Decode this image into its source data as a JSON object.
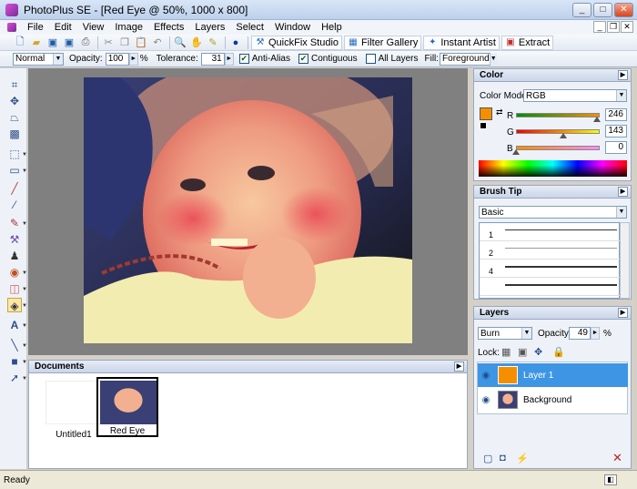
{
  "window": {
    "title": "PhotoPlus SE - [Red Eye @ 50%, 1000 x 800]",
    "btn_min": "_",
    "btn_max": "□",
    "btn_close": "✕"
  },
  "menu": {
    "items": [
      "File",
      "Edit",
      "View",
      "Image",
      "Effects",
      "Layers",
      "Select",
      "Window",
      "Help"
    ]
  },
  "toolbar": {
    "quickfix": "QuickFix Studio",
    "filter_gallery": "Filter Gallery",
    "instant_artist": "Instant Artist",
    "extract": "Extract"
  },
  "context_bar": {
    "mode": "Normal",
    "opacity_label": "Opacity:",
    "opacity_value": "100",
    "opacity_unit": "%",
    "tolerance_label": "Tolerance:",
    "tolerance_value": "31",
    "anti_alias": "Anti-Alias",
    "contiguous": "Contiguous",
    "all_layers": "All Layers",
    "fill_label": "Fill:",
    "fill_value": "Foreground"
  },
  "documents": {
    "title": "Documents",
    "items": [
      {
        "name": "Untitled1"
      },
      {
        "name": "Red Eye"
      }
    ]
  },
  "color_panel": {
    "title": "Color",
    "mode_label": "Color Mode:",
    "mode_value": "RGB",
    "r_label": "R",
    "r_value": "246",
    "g_label": "G",
    "g_value": "143",
    "b_label": "B",
    "b_value": "0",
    "swatch_color": "#f68f00"
  },
  "brush_panel": {
    "title": "Brush Tip",
    "category": "Basic",
    "items": [
      "1",
      "2",
      "4"
    ]
  },
  "layers_panel": {
    "title": "Layers",
    "blend_mode": "Burn",
    "opacity_label": "Opacity:",
    "opacity_value": "49",
    "opacity_unit": "%",
    "lock_label": "Lock:",
    "layers": [
      {
        "name": "Layer 1",
        "selected": true
      },
      {
        "name": "Background",
        "selected": false
      }
    ]
  },
  "status": {
    "text": "Ready"
  }
}
